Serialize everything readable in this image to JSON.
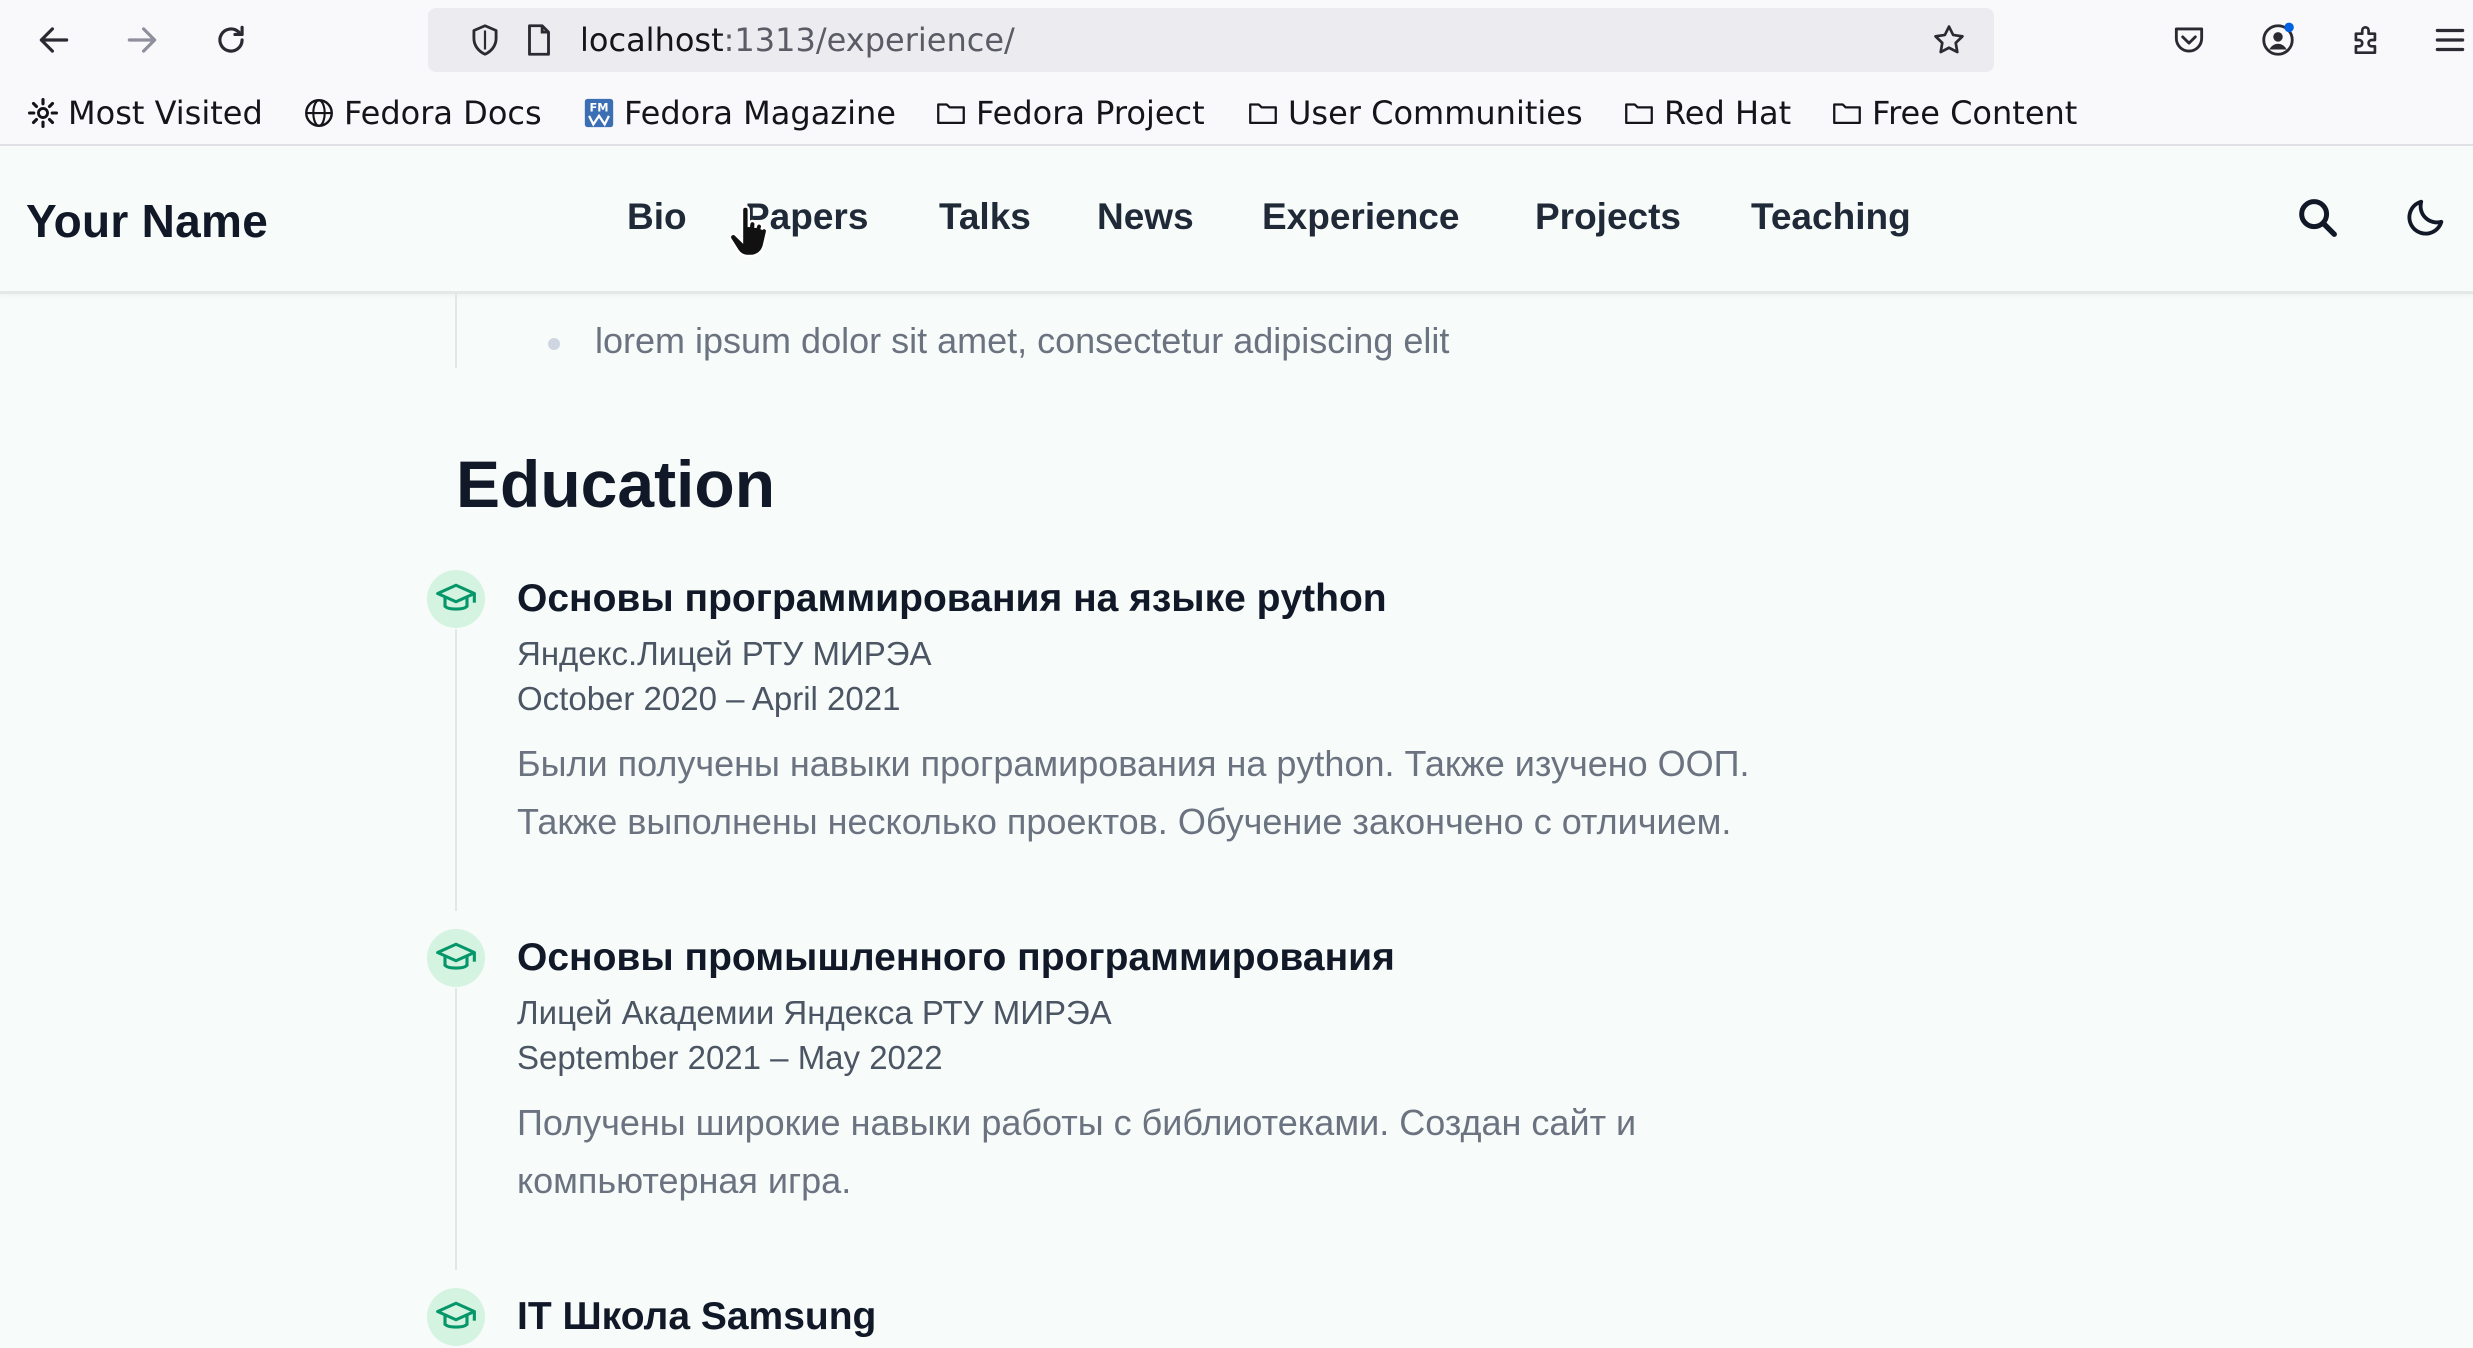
{
  "browser": {
    "url_host": "localhost",
    "url_path": ":1313/experience/",
    "bookmarks": [
      {
        "label": "Most Visited",
        "icon": "gear-icon"
      },
      {
        "label": "Fedora Docs",
        "icon": "globe-icon"
      },
      {
        "label": "Fedora Magazine",
        "icon": "fedora-magazine-icon"
      },
      {
        "label": "Fedora Project",
        "icon": "folder-icon"
      },
      {
        "label": "User Communities",
        "icon": "folder-icon"
      },
      {
        "label": "Red Hat",
        "icon": "folder-icon"
      },
      {
        "label": "Free Content",
        "icon": "folder-icon"
      }
    ]
  },
  "site": {
    "brand": "Your Name",
    "nav": [
      "Bio",
      "Papers",
      "Talks",
      "News",
      "Experience",
      "Projects",
      "Teaching"
    ]
  },
  "content": {
    "previous_bullet": "lorem ipsum dolor sit amet, consectetur adipiscing elit",
    "section_title": "Education",
    "education": [
      {
        "title": "Основы программирования на языке python",
        "org": "Яндекс.Лицей РТУ МИРЭА",
        "date": "October 2020 – April 2021",
        "desc_lines": [
          "Были получены навыки програмирования на python. Также изучено ООП.",
          "Также выполнены несколько проектов. Обучение закончено с отличием."
        ]
      },
      {
        "title": "Основы промышленного программирования",
        "org": "Лицей Академии Яндекса РТУ МИРЭА",
        "date": "September 2021 – May 2022",
        "desc_lines": [
          "Получены широкие навыки работы с библиотеками. Создан сайт и",
          "компьютерная игра."
        ]
      },
      {
        "title": "IT Школа Samsung"
      }
    ]
  },
  "colors": {
    "page_bg": "#f7fbf9",
    "accent_green": "#059669",
    "icon_bg": "#d5f3e1"
  }
}
